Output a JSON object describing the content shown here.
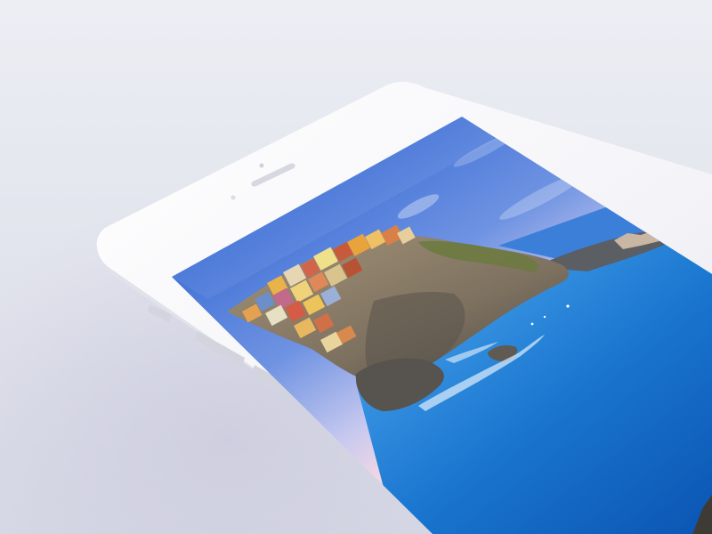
{
  "colors": {
    "background_top": "#e9ebf2",
    "background_bottom": "#d9dbe6",
    "device_body": "#f7f7fa",
    "device_edge": "#e2e3ea",
    "sky_top": "#3b6fd6",
    "sky_horizon": "#b9c6ee",
    "sky_glow": "#f0d3e0",
    "sea_dark": "#0e5fbf",
    "sea_light": "#2f93e0",
    "rock": "#8e8169",
    "rock_shadow": "#4f4a44",
    "vegetation": "#6a7a3c"
  },
  "scene": {
    "device": "white-smartphone",
    "wallpaper": "coastal-village-on-cliff-above-blue-sea"
  }
}
